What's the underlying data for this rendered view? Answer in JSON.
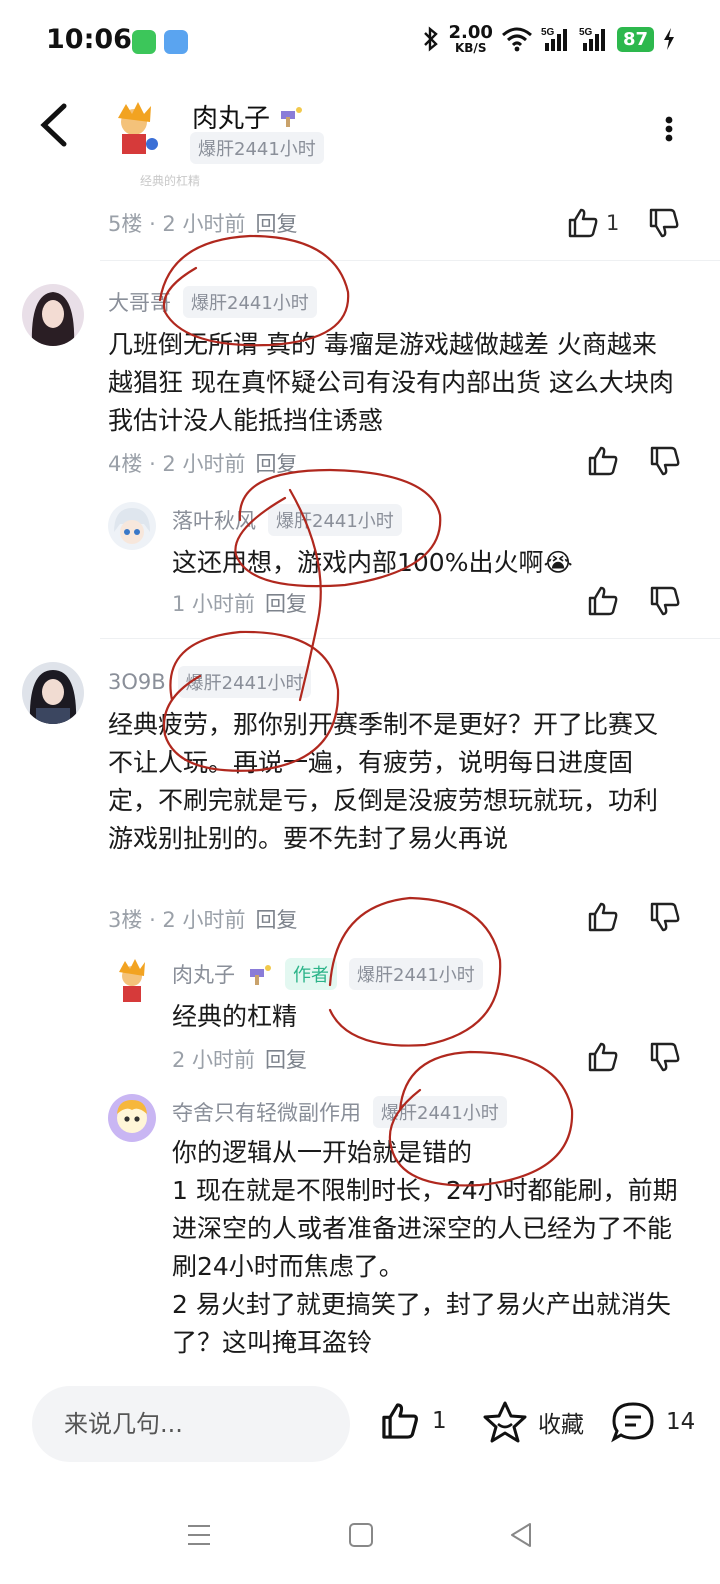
{
  "status": {
    "time": "10:06",
    "speed_value": "2.00",
    "speed_unit": "KB/S",
    "battery": "87"
  },
  "header": {
    "author_name": "肉丸子",
    "author_badge": "爆肝2441小时"
  },
  "faint_text": "经典的杠精",
  "first_comment": {
    "floor": "5楼",
    "time": "· 2 小时前",
    "reply": "回复",
    "likes": "1"
  },
  "comments": [
    {
      "user": "大哥哥",
      "badge": "爆肝2441小时",
      "text": "几班倒无所谓 真的 毒瘤是游戏越做越差 火商越来越猖狂  现在真怀疑公司有没有内部出货 这么大块肉 我估计没人能抵挡住诱惑",
      "floor": "4楼",
      "time": "· 2 小时前",
      "reply": "回复"
    },
    {
      "user": "落叶秋风",
      "badge": "爆肝2441小时",
      "text": "这还用想，游戏内部100%出火啊😭",
      "time": "1 小时前",
      "reply": "回复"
    },
    {
      "user": "3O9B",
      "badge": "爆肝2441小时",
      "text": "经典疲劳，那你别开赛季制不是更好？开了比赛又不让人玩。再说一遍，有疲劳，说明每日进度固定，不刷完就是亏，反倒是没疲劳想玩就玩，功利游戏别扯别的。要不先封了易火再说",
      "floor": "3楼",
      "time": "· 2 小时前",
      "reply": "回复"
    },
    {
      "user": "肉丸子",
      "author_tag": "作者",
      "badge": "爆肝2441小时",
      "text": "经典的杠精",
      "time": "2 小时前",
      "reply": "回复"
    },
    {
      "user": "夺舍只有轻微副作用",
      "badge": "爆肝2441小时",
      "lines": [
        "你的逻辑从一开始就是错的",
        "1 现在就是不限制时长，24小时都能刷，前期进深空的人或者准备进深空的人已经为了不能刷24小时而焦虑了。",
        "2 易火封了就更搞笑了，封了易火产出就消失了？这叫掩耳盗铃"
      ]
    }
  ],
  "bottom": {
    "input_placeholder": "来说几句...",
    "like_count": "1",
    "favorite_label": "收藏",
    "comment_count": "14"
  },
  "colors": {
    "badge_bg": "#f1f3f6",
    "author_tag": "#2cb489",
    "marker": "#b0281e",
    "battery": "#2db84d"
  }
}
